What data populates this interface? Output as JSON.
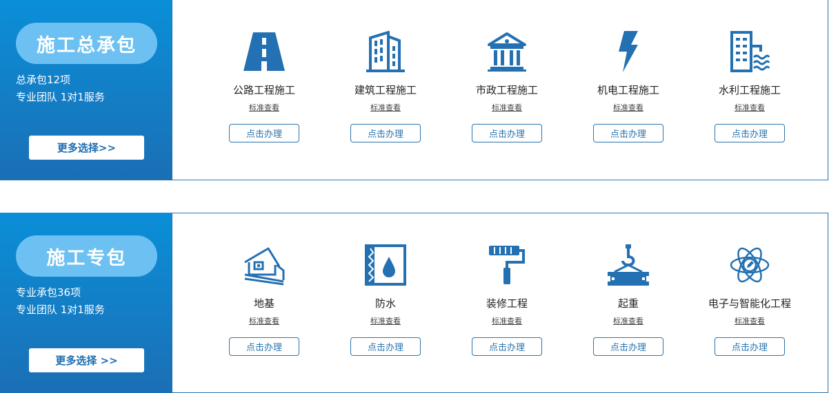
{
  "sections": [
    {
      "title": "施工总承包",
      "line1": "总承包12项",
      "line2": "专业团队 1对1服务",
      "more_label": "更多选择>>",
      "items": [
        {
          "name": "公路工程施工",
          "link": "标准查看",
          "button": "点击办理",
          "icon": "highway-icon"
        },
        {
          "name": "建筑工程施工",
          "link": "标准查看",
          "button": "点击办理",
          "icon": "building-icon"
        },
        {
          "name": "市政工程施工",
          "link": "标准查看",
          "button": "点击办理",
          "icon": "municipal-hall-icon"
        },
        {
          "name": "机电工程施工",
          "link": "标准查看",
          "button": "点击办理",
          "icon": "lightning-icon"
        },
        {
          "name": "水利工程施工",
          "link": "标准查看",
          "button": "点击办理",
          "icon": "water-building-icon"
        }
      ]
    },
    {
      "title": "施工专包",
      "line1": "专业承包36项",
      "line2": "专业团队 1对1服务",
      "more_label": "更多选择 >>",
      "items": [
        {
          "name": "地基",
          "link": "标准查看",
          "button": "点击办理",
          "icon": "foundation-house-icon"
        },
        {
          "name": "防水",
          "link": "标准查看",
          "button": "点击办理",
          "icon": "waterproof-icon"
        },
        {
          "name": "装修工程",
          "link": "标准查看",
          "button": "点击办理",
          "icon": "paint-roller-icon"
        },
        {
          "name": "起重",
          "link": "标准查看",
          "button": "点击办理",
          "icon": "crane-hook-icon"
        },
        {
          "name": "电子与智能化工程",
          "link": "标准查看",
          "button": "点击办理",
          "icon": "atom-icon"
        }
      ]
    }
  ],
  "colors": {
    "primary": "#1b6fb5",
    "accent": "#0a8fd8",
    "pill": "#6cc0f2",
    "border": "#2a74ad",
    "icon": "#2370b2"
  }
}
